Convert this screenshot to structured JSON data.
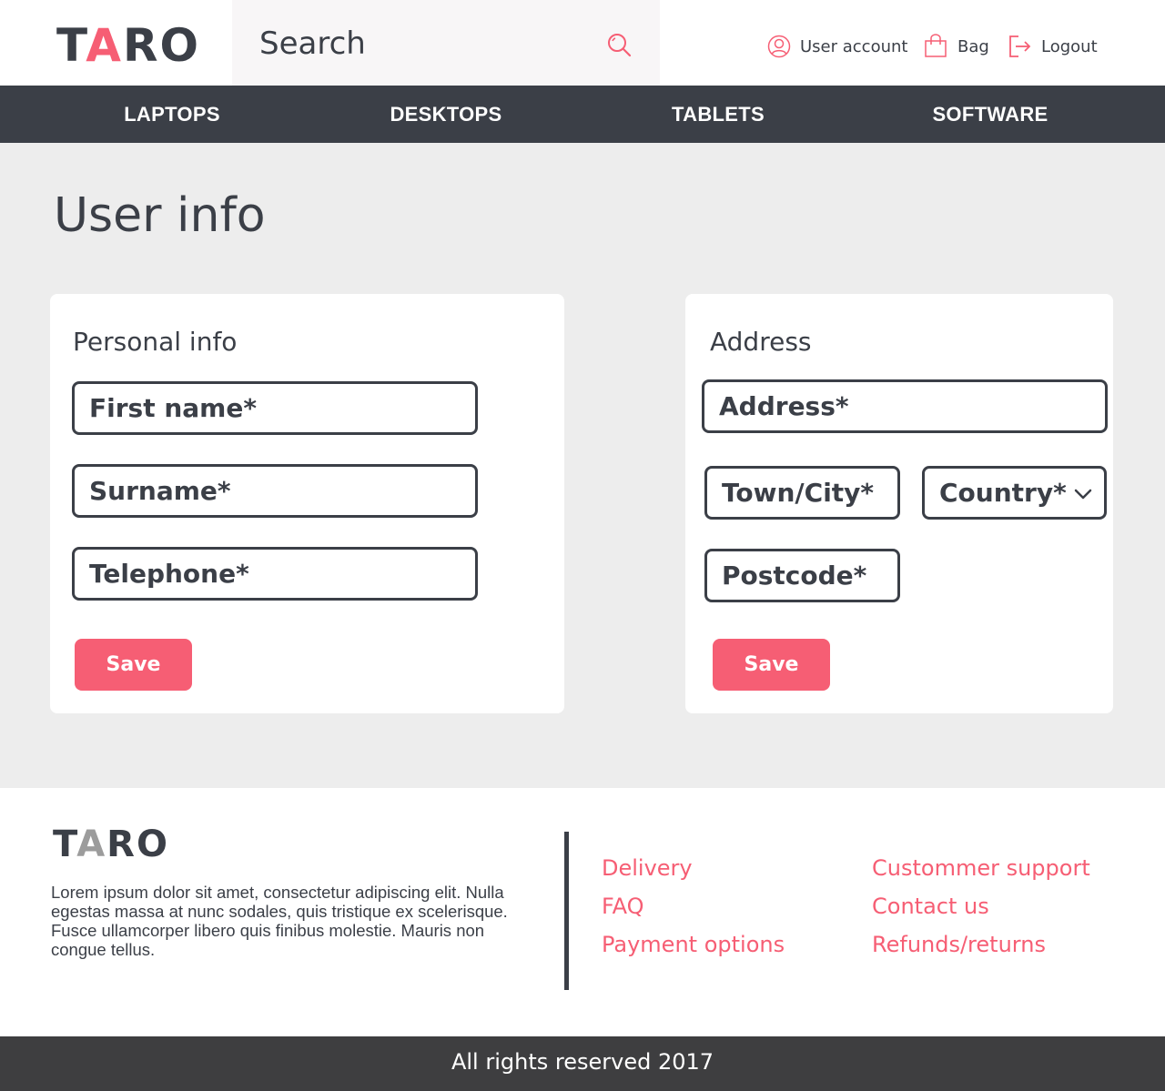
{
  "brand": {
    "logo_first": "T",
    "logo_accent": "A",
    "logo_rest": "RO",
    "accent_color": "#f65e74",
    "dark_color": "#3b3f47"
  },
  "header": {
    "search_placeholder": "Search",
    "search_icon": "search-icon",
    "actions": [
      {
        "label": "User account",
        "icon": "user-icon"
      },
      {
        "label": "Bag",
        "icon": "bag-icon"
      },
      {
        "label": "Logout",
        "icon": "logout-icon"
      }
    ]
  },
  "nav": {
    "items": [
      "LAPTOPS",
      "DESKTOPS",
      "TABLETS",
      "SOFTWARE"
    ]
  },
  "main": {
    "title": "User info",
    "personal": {
      "title": "Personal info",
      "fields": [
        "First name*",
        "Surname*",
        "Telephone*"
      ],
      "save_label": "Save"
    },
    "address": {
      "title": "Address",
      "address_field": "Address*",
      "city_field": "Town/City*",
      "country_field": "Country*",
      "postcode_field": "Postcode*",
      "save_label": "Save"
    }
  },
  "footer": {
    "logo_first": "T",
    "logo_accent": "A",
    "logo_rest": "RO",
    "description": "Lorem ipsum dolor sit amet, consectetur adipiscing elit. Nulla egestas massa at nunc sodales, quis tristique ex scelerisque. Fusce ullamcorper libero quis finibus molestie. Mauris non congue tellus.",
    "links_col1": [
      "Delivery",
      "FAQ",
      "Payment options"
    ],
    "links_col2": [
      "Custommer support",
      "Contact us",
      "Refunds/returns"
    ],
    "copyright": "All rights reserved 2017"
  }
}
